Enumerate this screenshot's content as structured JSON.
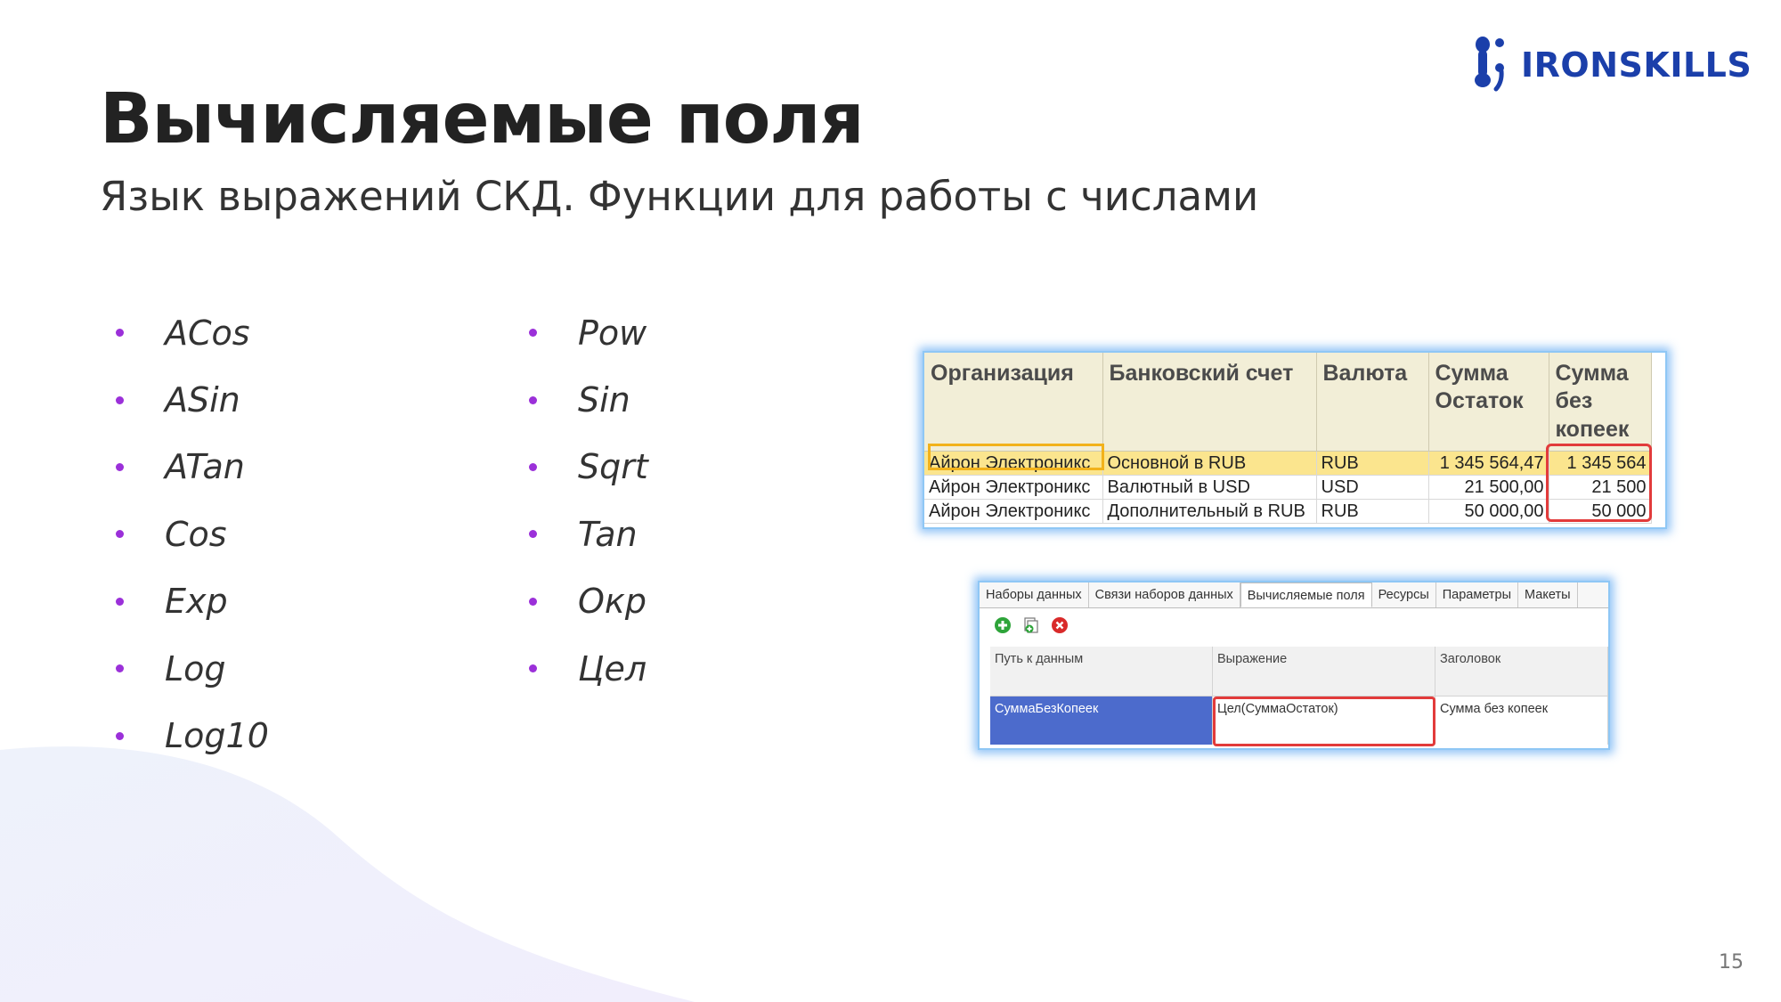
{
  "slide": {
    "title": "Вычисляемые поля",
    "subtitle": "Язык выражений СКД. Функции для работы с числами",
    "page_number": "15"
  },
  "logo": {
    "text": "IRONSKILLS"
  },
  "functions_left": [
    "ACos",
    "ASin",
    "ATan",
    "Cos",
    "Exp",
    "Log",
    "Log10"
  ],
  "functions_right": [
    "Pow",
    "Sin",
    "Sqrt",
    "Tan",
    "Окр",
    "Цел"
  ],
  "report_table": {
    "headers": [
      "Организация",
      "Банковский счет",
      "Валюта",
      "Сумма Остаток",
      "Сумма без копеек"
    ],
    "rows": [
      [
        "Айрон Электроникс",
        "Основной в RUB",
        "RUB",
        "1 345 564,47",
        "1 345 564"
      ],
      [
        "Айрон Электроникс",
        "Валютный в USD",
        "USD",
        "21 500,00",
        "21 500"
      ],
      [
        "Айрон Электроникс",
        "Дополнительный в RUB",
        "RUB",
        "50 000,00",
        "50 000"
      ]
    ]
  },
  "settings_editor": {
    "tabs": [
      "Наборы данных",
      "Связи наборов данных",
      "Вычисляемые поля",
      "Ресурсы",
      "Параметры",
      "Макеты"
    ],
    "active_tab": "Вычисляемые поля",
    "toolbar": [
      "add-icon",
      "copy-icon",
      "delete-icon"
    ],
    "columns": [
      "Путь к данным",
      "Выражение",
      "Заголовок"
    ],
    "row": [
      "СуммаБезКопеек",
      "Цел(СуммаОстаток)",
      "Сумма без копеек"
    ]
  },
  "colors": {
    "accent": "#9b30d9",
    "brand": "#1b3faa",
    "highlight_red": "#e23b3b",
    "highlight_orange": "#f2b21b",
    "selection_blue": "#4c6bcc"
  }
}
